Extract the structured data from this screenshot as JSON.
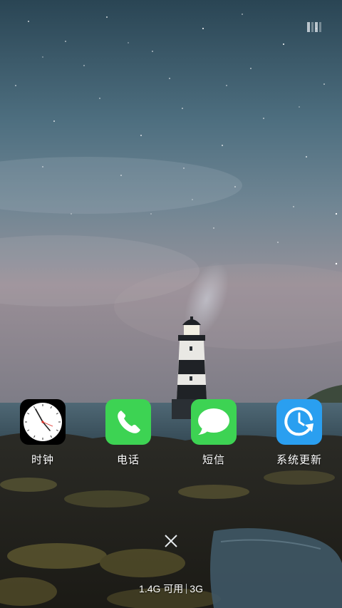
{
  "apps": [
    {
      "label": "时钟",
      "icon": "clock-icon",
      "color": "#000000"
    },
    {
      "label": "电话",
      "icon": "phone-icon",
      "color": "#3dd353"
    },
    {
      "label": "短信",
      "icon": "message-icon",
      "color": "#3dd353"
    },
    {
      "label": "系统更新",
      "icon": "update-icon",
      "color": "#2a9ff0"
    }
  ],
  "footer": {
    "memory": "1.4G 可用",
    "network": "3G"
  }
}
